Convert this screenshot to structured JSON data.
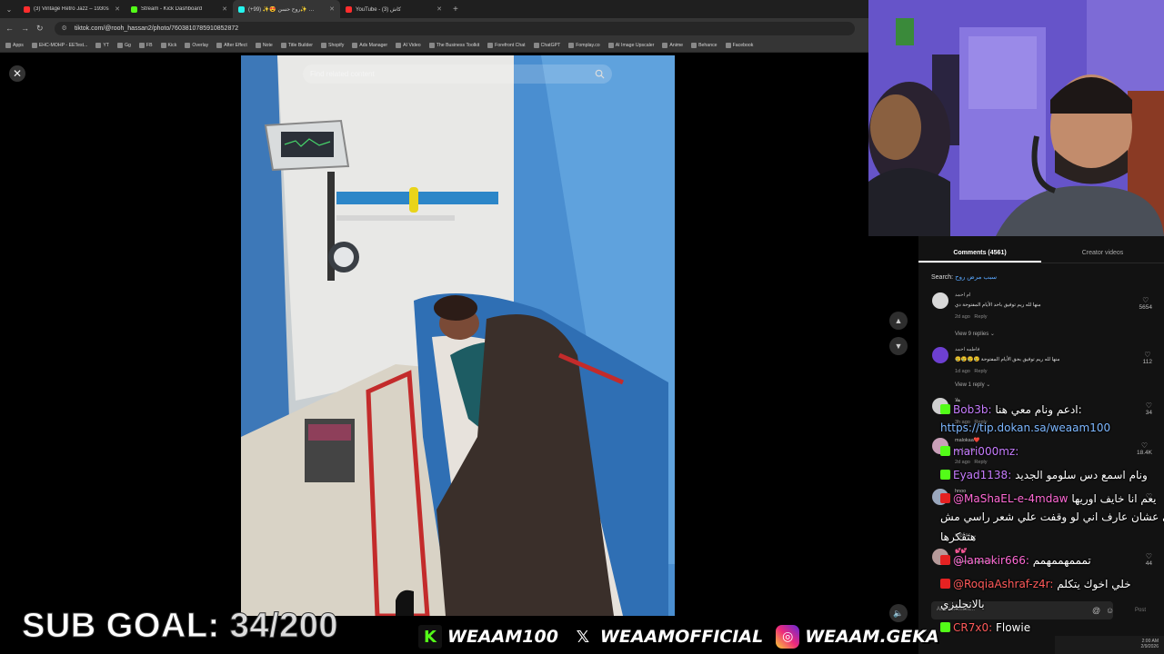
{
  "browser": {
    "tabs": [
      {
        "title": "(3) Vintage Retro Jazz – 1930s",
        "color": "#ff2d2d",
        "active": false
      },
      {
        "title": "Stream - Kick Dashboard",
        "color": "#53fc18",
        "active": false
      },
      {
        "title": "(+99) ✨😍 روح حسن✨ …",
        "color": "#25f4ee",
        "active": true
      },
      {
        "title": "YouTube - (3) كاش",
        "color": "#ff2d2d",
        "active": false
      }
    ],
    "url": "tiktok.com/@rooh_hassan2/photo/7603810785910852872",
    "bookmarks": [
      "Apps",
      "EHC-MOHP - EETest...",
      "YT",
      "Gg",
      "FB",
      "Kick",
      "Overlay",
      "After Effect",
      "Note",
      "Title Builder",
      "Shopify",
      "Ads Manager",
      "AI Video",
      "The Business Toolkit",
      "Forefront Chat",
      "ChatGPT",
      "Fomplay.co",
      "AI Image Upscaler",
      "Anime",
      "Behance",
      "Facebook"
    ]
  },
  "viewer": {
    "search_placeholder": "Find related content",
    "close_icon": "close-icon",
    "up_arrow": "▲",
    "down_arrow": "▼"
  },
  "comments_panel": {
    "tabs": [
      "Comments (4561)",
      "Creator videos"
    ],
    "search_label": "Search:",
    "search_query": "سبب مرض روح",
    "comments": [
      {
        "name": "ام احمد",
        "text": "منها لله ريم توفيق باحد الأيام المفتوحة دي",
        "time": "2d ago",
        "reply": "Reply",
        "likes": "5654",
        "replies": "View 9 replies",
        "avatar_color": "#d8d8d8"
      },
      {
        "name": "فاطمه احمد",
        "text": "منها لله ريم توفيق بحق الأيام المفتوحة 😢😢😢😢",
        "time": "1d ago",
        "reply": "Reply",
        "likes": "112",
        "replies": "View 1 reply",
        "avatar_color": "#6d3fd1"
      },
      {
        "name": "هلا",
        "text": "",
        "time": "3h ago",
        "reply": "Reply",
        "likes": "34",
        "replies": "",
        "avatar_color": "#cfcfcf"
      },
      {
        "name": "malokaa❤️",
        "text": "ذكي يا بيه",
        "time": "2d ago",
        "reply": "Reply",
        "likes": "18.4K",
        "replies": "",
        "avatar_color": "#c9a0b8"
      },
      {
        "name": "hnoo",
        "text": "",
        "time": "",
        "reply": "",
        "likes": "",
        "replies": "replies",
        "avatar_color": "#9aa7bd"
      },
      {
        "name": "💕💕",
        "text": "ربنا يشفيها و يحفظها",
        "time": "",
        "reply": "",
        "likes": "44",
        "replies": "",
        "avatar_color": "#b69a9a"
      }
    ],
    "add_comment_placeholder": "Add comment...",
    "post_label": "Post"
  },
  "chat": [
    {
      "badge": "kick",
      "user": "Bob3b:",
      "user_color": "purple",
      "text": "ادعم ونام معي هنا:"
    },
    {
      "badge": "",
      "user": "",
      "user_color": "",
      "text": "https://tip.dokan.sa/weaam100",
      "is_link": true
    },
    {
      "badge": "kick",
      "user": "mari000mz:",
      "user_color": "purple",
      "text": ""
    },
    {
      "badge": "kick",
      "user": "Eyad1138:",
      "user_color": "purple",
      "text": "ونام اسمع دس سلومو الجديد"
    },
    {
      "badge": "yt",
      "user": "@MaShaEL-e-4mdaw",
      "user_color": "pink",
      "text": "يعم انا خايف اوريها"
    },
    {
      "badge": "",
      "user": "",
      "user_color": "",
      "text": "الظلي عشان عارف اني لو وقفت علي شعر راسي مش"
    },
    {
      "badge": "",
      "user": "",
      "user_color": "",
      "text": "هتفكرها"
    },
    {
      "badge": "yt",
      "user": "@lamakir666:",
      "user_color": "pink",
      "text": "تمممهممهمم"
    },
    {
      "badge": "yt",
      "user": "@RoqiaAshraf-z4r:",
      "user_color": "red",
      "text": "خلي اخوك يتكلم"
    },
    {
      "badge": "",
      "user": "",
      "user_color": "",
      "text": "بالانجليزي"
    },
    {
      "badge": "kick",
      "user": "CR7x0:",
      "user_color": "red",
      "text": "Flowie"
    }
  ],
  "overlay": {
    "subgoal_label": "SUB GOAL:",
    "subgoal_value": "34/200",
    "subgoal_current": 34,
    "subgoal_target": 200,
    "socials": [
      {
        "icon": "kick-icon",
        "glyph": "K",
        "handle": "WEAAM100"
      },
      {
        "icon": "x-icon",
        "glyph": "𝕏",
        "handle": "WEAAMOFFICIAL"
      },
      {
        "icon": "instagram-icon",
        "glyph": "◎",
        "handle": "WEAAM.GEKA"
      }
    ]
  },
  "taskbar": {
    "time": "2:00 AM",
    "date": "2/9/2026"
  }
}
